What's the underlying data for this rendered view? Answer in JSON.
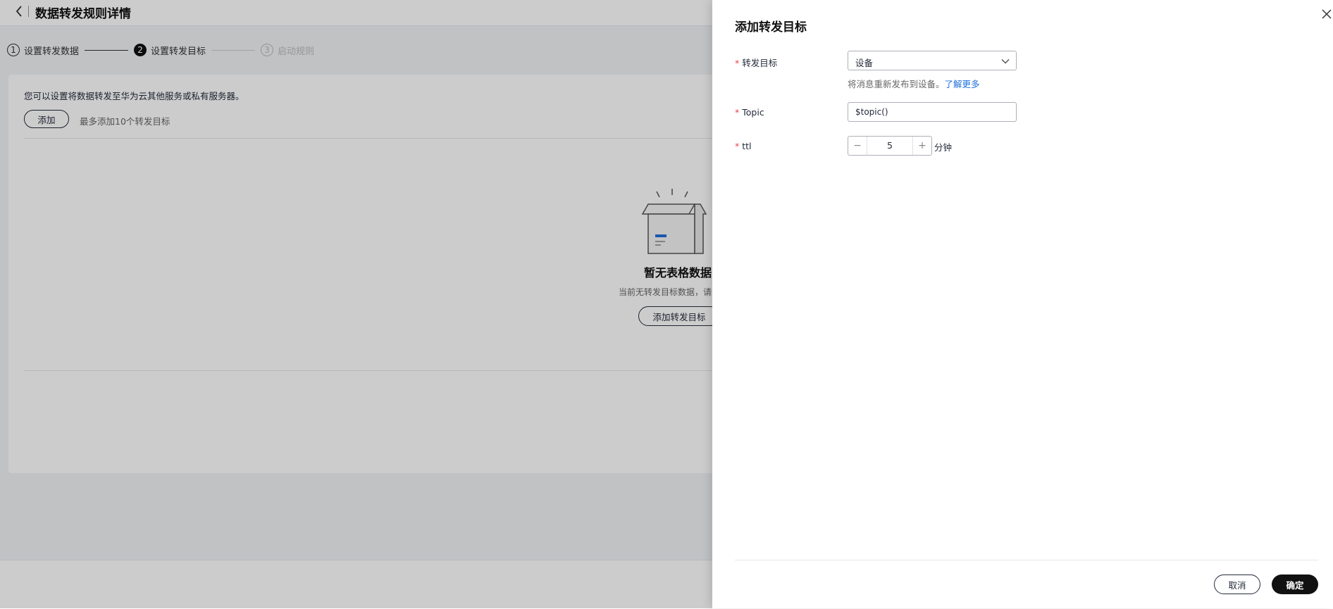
{
  "page": {
    "title": "数据转发规则详情"
  },
  "steps": [
    {
      "number": "1",
      "label": "设置转发数据",
      "state": "done"
    },
    {
      "number": "2",
      "label": "设置转发目标",
      "state": "active"
    },
    {
      "number": "3",
      "label": "启动规则",
      "state": "wait"
    }
  ],
  "content": {
    "intro": "您可以设置将数据转发至华为云其他服务或私有服务器。",
    "add_label": "添加",
    "max_tip": "最多添加10个转发目标",
    "empty_title": "暂无表格数据",
    "empty_desc": "当前无转发目标数据，请先添加",
    "empty_add_label": "添加转发目标"
  },
  "drawer": {
    "title": "添加转发目标",
    "fields": {
      "target": {
        "label": "转发目标",
        "value": "设备"
      },
      "hint_text": "将消息重新发布到设备。",
      "hint_link": "了解更多",
      "topic": {
        "label": "Topic",
        "value": "$topic()"
      },
      "ttl": {
        "label": "ttl",
        "value": "5",
        "unit": "分钟"
      }
    },
    "footer": {
      "cancel_label": "取消",
      "confirm_label": "确定"
    }
  },
  "colors": {
    "accent_link": "#1e6fdb",
    "required": "#e54545",
    "primary_button": "#111111"
  }
}
